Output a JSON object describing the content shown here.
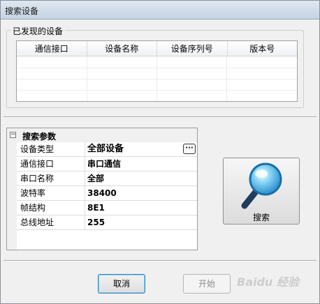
{
  "window": {
    "title": "搜索设备"
  },
  "discovered": {
    "legend": "已发现的设备",
    "columns": [
      "通信接口",
      "设备名称",
      "设备序列号",
      "版本号"
    ]
  },
  "params": {
    "category": "搜索参数",
    "toggle": "⊟",
    "rows": [
      {
        "name": "设备类型",
        "value": "全部设备",
        "button": "···"
      },
      {
        "name": "通信接口",
        "value": "串口通信"
      },
      {
        "name": "串口名称",
        "value": "全部"
      },
      {
        "name": "波特率",
        "value": "38400"
      },
      {
        "name": "帧结构",
        "value": "8E1"
      },
      {
        "name": "总线地址",
        "value": "255"
      }
    ]
  },
  "search_button": {
    "label": "搜索",
    "icon": "magnifier-icon"
  },
  "buttons": {
    "cancel": "取消",
    "start": "开始"
  },
  "watermark": "Baidu 经验",
  "colors": {
    "accent_blue": "#1c86c6",
    "handle": "#1e3c5c"
  }
}
